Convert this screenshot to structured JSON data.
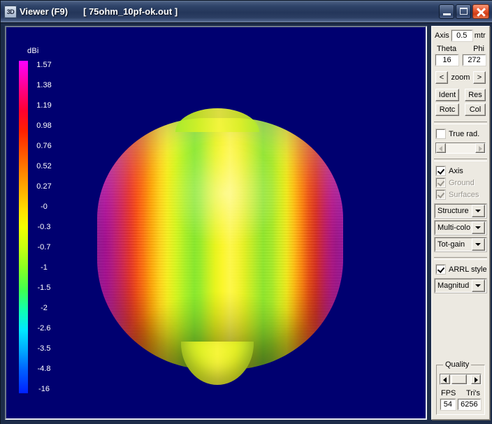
{
  "window": {
    "icon": "3d-icon",
    "icon_text": "3D",
    "title": "Viewer (F9)",
    "filename": "[  75ohm_10pf-ok.out ]",
    "minimize_label": "minimize-icon",
    "maximize_label": "maximize-icon",
    "close_label": "close-icon"
  },
  "viewport": {
    "background_color": "#000070",
    "legend": {
      "title": "dBi",
      "ticks": [
        "1.57",
        "1.38",
        "1.19",
        "0.98",
        "0.76",
        "0.52",
        "0.27",
        "-0",
        "-0.3",
        "-0.7",
        "-1",
        "-1.5",
        "-2",
        "-2.6",
        "-3.5",
        "-4.8",
        "-16"
      ]
    },
    "pattern": {
      "name": "3d-radiation-pattern",
      "description": "rounded-cube far-field gain surface, multi-color vertical bands"
    }
  },
  "panel": {
    "axis": {
      "label": "Axis",
      "value": "0.5",
      "unit": "mtr"
    },
    "angles": {
      "theta_label": "Theta",
      "phi_label": "Phi",
      "theta_value": "16",
      "phi_value": "272"
    },
    "zoom": {
      "left": "<",
      "label": "zoom",
      "right": ">"
    },
    "buttons": {
      "ident": "Ident",
      "res": "Res",
      "rotc": "Rotc",
      "col": "Col"
    },
    "true_rad": {
      "label": "True rad.",
      "checked": false
    },
    "checkboxes": [
      {
        "label": "Axis",
        "checked": true,
        "enabled": true
      },
      {
        "label": "Ground",
        "checked": true,
        "enabled": false
      },
      {
        "label": "Surfaces",
        "checked": true,
        "enabled": false
      }
    ],
    "selects": [
      {
        "name": "structure-select",
        "value": "Structure"
      },
      {
        "name": "color-mode-select",
        "value": "Multi-colo"
      },
      {
        "name": "gain-type-select",
        "value": "Tot-gain"
      }
    ],
    "arrl": {
      "label": "ARRL style",
      "checked": true
    },
    "magnitude_select": {
      "name": "magnitude-select",
      "value": "Magnitud"
    },
    "quality": {
      "label": "Quality",
      "fps_label": "FPS",
      "tris_label": "Tri's",
      "fps_value": "54",
      "tris_value": "6256"
    }
  }
}
